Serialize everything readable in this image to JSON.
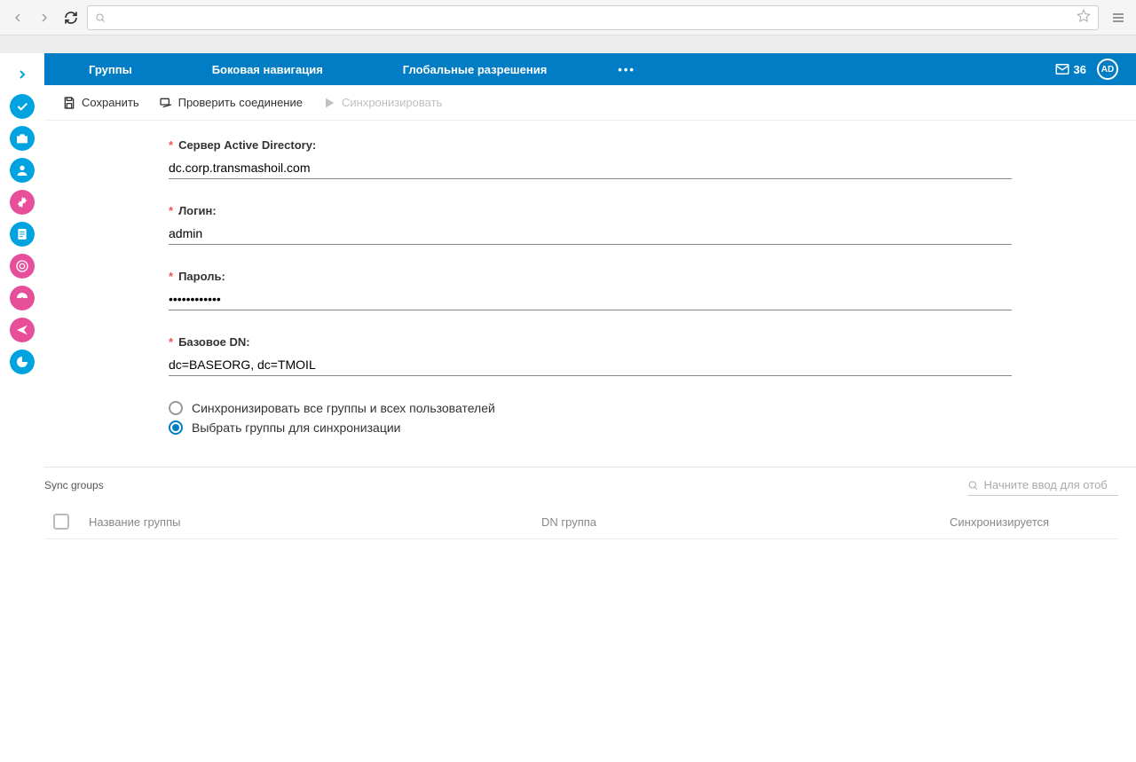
{
  "browser": {
    "url": ""
  },
  "topnav": {
    "tabs": [
      "Группы",
      "Боковая навигация",
      "Глобальные разрешения"
    ],
    "more": "•••",
    "mail_count": "36",
    "avatar": "AD"
  },
  "toolbar": {
    "save": "Сохранить",
    "test": "Проверить соединение",
    "sync": "Синхронизировать"
  },
  "form": {
    "server_label": "Сервер Active Directory:",
    "server_value": "dc.corp.transmashoil.com",
    "login_label": "Логин:",
    "login_value": "admin",
    "password_label": "Пароль:",
    "password_value": "••••••••••••",
    "basedn_label": "Базовое DN:",
    "basedn_value": "dc=BASEORG, dc=TMOIL",
    "radio_all": "Синхронизировать все группы и всех пользователей",
    "radio_select": "Выбрать группы для синхронизации"
  },
  "sync": {
    "title": "Sync groups",
    "search_placeholder": "Начните ввод для отоб",
    "col_name": "Название группы",
    "col_dn": "DN группа",
    "col_sync": "Синхронизируется"
  }
}
